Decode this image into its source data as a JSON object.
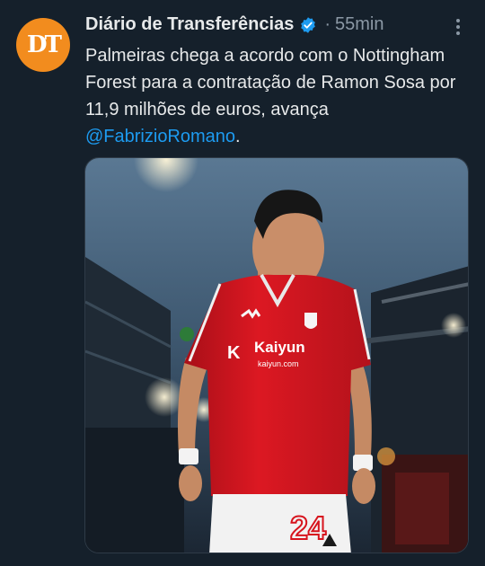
{
  "author": {
    "name": "Diário de Transferências",
    "avatar_initials": "DT",
    "avatar_color": "#f28c1e",
    "verified": true
  },
  "meta": {
    "separator": "·",
    "time": "55min"
  },
  "tweet": {
    "text_before": "Palmeiras chega a acordo com o Nottingham Forest para a contratação de Ramon Sosa por 11,9 milhões de euros, avança ",
    "mention": "@FabrizioRomano",
    "text_after": "."
  },
  "media": {
    "shirt_sponsor": "Kaiyun",
    "shirt_sponsor_sub": "kaiyun.com",
    "shirt_number": "24",
    "shirt_color": "#d7141e"
  },
  "colors": {
    "background": "#15202b",
    "link": "#1d9bf0",
    "muted": "#8b98a5",
    "text": "#e7e9ea"
  }
}
